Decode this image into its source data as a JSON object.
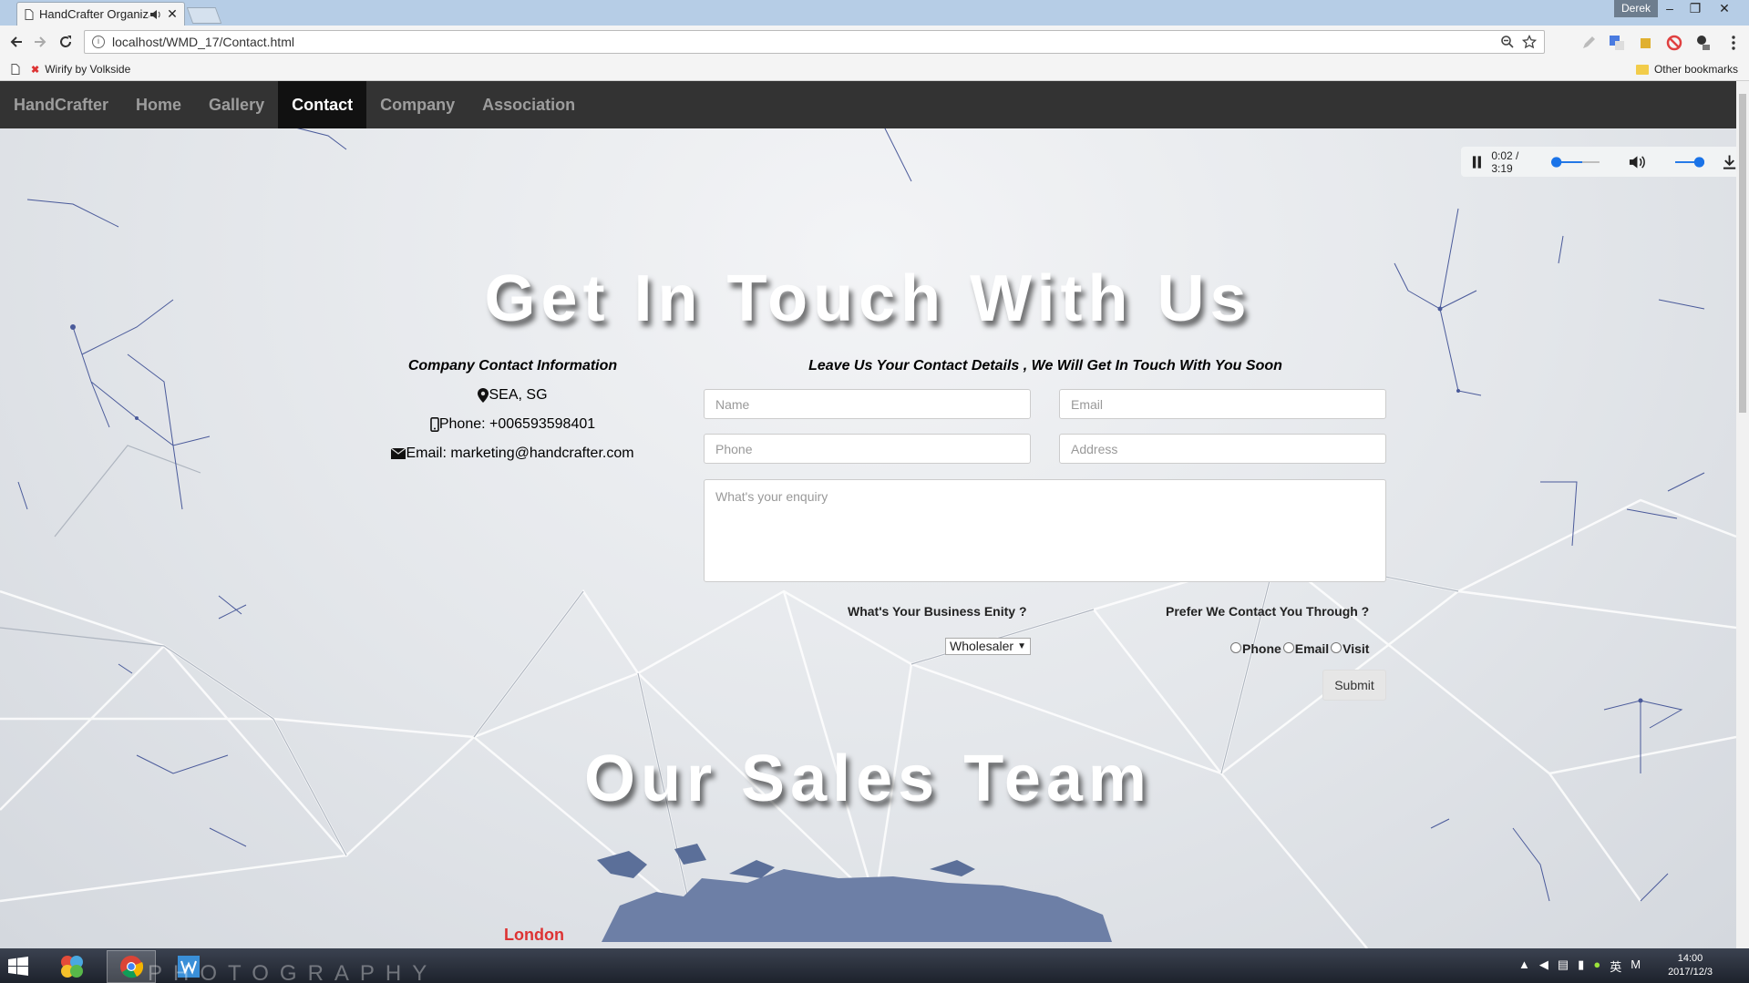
{
  "browser": {
    "tab_title": "HandCrafter Organiza",
    "url": "localhost/WMD_17/Contact.html",
    "user": "Derek",
    "bookmarks": [
      {
        "label": "Wirify by Volkside"
      }
    ],
    "other_bookmarks": "Other bookmarks"
  },
  "nav": {
    "brand": "HandCrafter",
    "items": [
      {
        "label": "Home",
        "active": false
      },
      {
        "label": "Gallery",
        "active": false
      },
      {
        "label": "Contact",
        "active": true
      },
      {
        "label": "Company",
        "active": false
      },
      {
        "label": "Association",
        "active": false
      }
    ]
  },
  "audio": {
    "time": "0:02 / 3:19"
  },
  "headings": {
    "get_in_touch": "Get In Touch With Us",
    "sales_team": "Our Sales Team"
  },
  "company_info": {
    "title": "Company Contact Information",
    "location": "SEA, SG",
    "phone": "Phone: +006593598401",
    "email": "Email: marketing@handcrafter.com"
  },
  "form": {
    "title": "Leave Us Your Contact Details , We Will Get In Touch With You Soon",
    "name_placeholder": "Name",
    "email_placeholder": "Email",
    "phone_placeholder": "Phone",
    "address_placeholder": "Address",
    "enquiry_placeholder": "What's your enquiry",
    "business_label": "What's Your Business Enity ?",
    "business_value": "Wholesaler",
    "contact_label": "Prefer We Contact You Through ?",
    "contact_options": [
      "Phone",
      "Email",
      "Visit"
    ],
    "submit": "Submit"
  },
  "map": {
    "city": "London"
  },
  "taskbar": {
    "watermark": "PHOTOGRAPHY",
    "time": "14:00",
    "date": "2017/12/3"
  },
  "colors": {
    "nav_bg": "#333333",
    "nav_active": "#111111",
    "accent_city": "#dd3333"
  }
}
